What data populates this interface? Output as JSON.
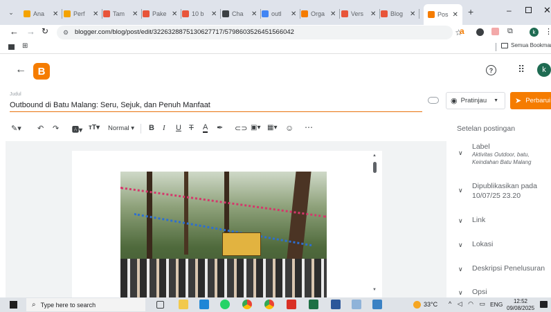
{
  "browser": {
    "tabs": [
      {
        "label": "Ana",
        "color": "#f4a300"
      },
      {
        "label": "Perf",
        "color": "#f4a300"
      },
      {
        "label": "Tam",
        "color": "#e8553a"
      },
      {
        "label": "Pake",
        "color": "#e8553a"
      },
      {
        "label": "10 b",
        "color": "#e8553a"
      },
      {
        "label": "Cha",
        "color": "#3c4043"
      },
      {
        "label": "outl",
        "color": "#4285f4"
      },
      {
        "label": "Orga",
        "color": "#f57c00"
      },
      {
        "label": "Vers",
        "color": "#e8553a"
      },
      {
        "label": "Blog",
        "color": "#e8553a"
      }
    ],
    "active_tab": {
      "label": "Pos",
      "color": "#f57c00"
    },
    "url": "blogger.com/blog/post/edit/3226328875130627717/5798603526451566042",
    "bookmarks_label": "Semua Bookmark",
    "profile_initial": "k"
  },
  "app": {
    "avatar_initial": "k",
    "title_label": "Judul",
    "post_title": "Outbound di Batu Malang: Seru, Sejuk, dan Penuh Manfaat",
    "preview_label": "Pratinjau",
    "update_label": "Perbarui"
  },
  "toolbar": {
    "format_label": "Normal"
  },
  "sidebar": {
    "heading": "Setelan postingan",
    "label_title": "Label",
    "label_value": "Aktivitas Outdoor, batu, Keindahan Batu Malang",
    "published_title": "Dipublikasikan pada",
    "published_value": "10/07/25 23.20",
    "link": "Link",
    "location": "Lokasi",
    "search_description": "Deskripsi Penelusuran",
    "options": "Opsi"
  },
  "taskbar": {
    "search_placeholder": "Type here to search",
    "temperature": "33°C",
    "language": "ENG",
    "time": "12:52",
    "date": "09/08/2025"
  },
  "colors": {
    "blogger_orange": "#f57c00",
    "title_underline": "#e8710a",
    "avatar_green": "#1e6b52"
  }
}
